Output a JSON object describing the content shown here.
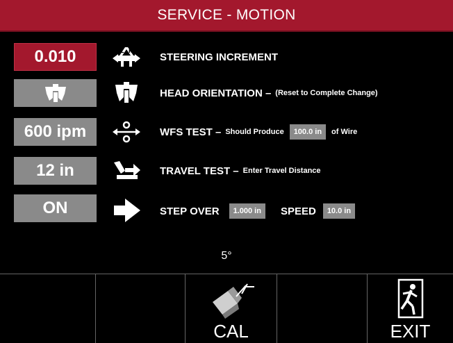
{
  "title": "SERVICE - MOTION",
  "rows": [
    {
      "value": "0.010",
      "label": "STEERING INCREMENT",
      "icon": "steering-lr-icon"
    },
    {
      "value": "",
      "label": "HEAD ORIENTATION –",
      "note": "(Reset to Complete Change)",
      "icon": "head-orientation-icon"
    },
    {
      "value": "600 ipm",
      "label": "WFS TEST –",
      "note": "Should Produce",
      "input": "100.0 in",
      "suffix": "of Wire",
      "icon": "wire-feed-icon"
    },
    {
      "value": "12 in",
      "label": "TRAVEL TEST –",
      "note": "Enter Travel Distance",
      "icon": "travel-icon"
    },
    {
      "value": "ON",
      "label": "STEP OVER",
      "input": "1.000 in",
      "label2": "SPEED",
      "input2": "10.0 in",
      "icon": "arrow-right-icon"
    }
  ],
  "angle": "5°",
  "buttons": [
    {
      "label": ""
    },
    {
      "label": ""
    },
    {
      "label": "CAL",
      "icon": "calibrate-torch-icon"
    },
    {
      "label": ""
    },
    {
      "label": "EXIT",
      "icon": "exit-door-icon"
    }
  ],
  "colors": {
    "accent": "#a3182d",
    "field": "#8a8a8a"
  }
}
